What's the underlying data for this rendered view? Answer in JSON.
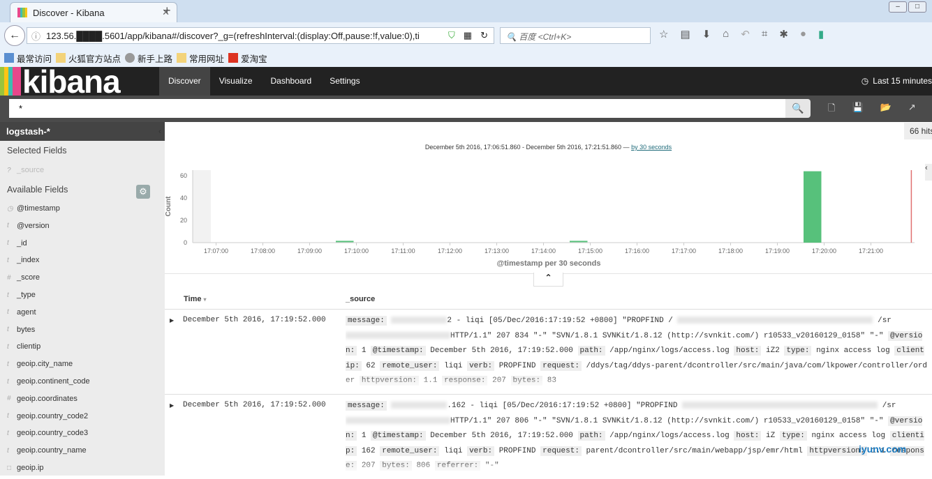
{
  "browser": {
    "tab_title": "Discover - Kibana",
    "url": "123.56.████.5601/app/kibana#/discover?_g=(refreshInterval:(display:Off,pause:!f,value:0),ti",
    "search_placeholder": "百度 <Ctrl+K>",
    "bookmarks": [
      "最常访问",
      "火狐官方站点",
      "新手上路",
      "常用网址",
      "爱淘宝"
    ]
  },
  "kibana": {
    "logo": "kibana",
    "nav": [
      "Discover",
      "Visualize",
      "Dashboard",
      "Settings"
    ],
    "time_picker": "Last 15 minutes",
    "query": "*"
  },
  "colors": {
    "bar": "#57c17b",
    "nav_bg": "#222222",
    "now_line": "#e07070"
  },
  "sidebar": {
    "index_pattern": "logstash-*",
    "selected_title": "Selected Fields",
    "selected": [
      {
        "type": "?",
        "name": "_source"
      }
    ],
    "available_title": "Available Fields",
    "fields": [
      {
        "type": "◷",
        "name": "@timestamp"
      },
      {
        "type": "t",
        "name": "@version"
      },
      {
        "type": "t",
        "name": "_id"
      },
      {
        "type": "t",
        "name": "_index"
      },
      {
        "type": "#",
        "name": "_score"
      },
      {
        "type": "t",
        "name": "_type"
      },
      {
        "type": "t",
        "name": "agent"
      },
      {
        "type": "t",
        "name": "bytes"
      },
      {
        "type": "t",
        "name": "clientip"
      },
      {
        "type": "t",
        "name": "geoip.city_name"
      },
      {
        "type": "t",
        "name": "geoip.continent_code"
      },
      {
        "type": "#",
        "name": "geoip.coordinates"
      },
      {
        "type": "t",
        "name": "geoip.country_code2"
      },
      {
        "type": "t",
        "name": "geoip.country_code3"
      },
      {
        "type": "t",
        "name": "geoip.country_name"
      },
      {
        "type": "□",
        "name": "geoip.ip"
      }
    ]
  },
  "main": {
    "hits": "66 hits",
    "range_text": "December 5th 2016, 17:06:51.860 - December 5th 2016, 17:21:51.860 —",
    "interval_link": "by 30 seconds",
    "columns": [
      "Time",
      "_source"
    ],
    "rows": [
      {
        "time": "December 5th 2016, 17:19:52.000",
        "parts": [
          [
            "message:",
            "2 - liqi [05/Dec/2016:17:19:52 +0800] \"PROPFIND /",
            "/sr"
          ],
          [
            "",
            "HTTP/1.1\" 207 834 \"-\" \"SVN/1.8.1 SVNKit/1.8.12 (http://svnkit.com/) r10533_v20160129_0158\" \"-\""
          ],
          [
            "@version:",
            "1"
          ],
          [
            "@timestamp:",
            "December 5th 2016, 17:19:52.000"
          ],
          [
            "path:",
            "/app/nginx/logs/access.log"
          ],
          [
            "host:",
            "iZ2"
          ],
          [
            "type:",
            "nginx access log"
          ],
          [
            "clientip:",
            "62"
          ],
          [
            "remote_user:",
            "liqi"
          ],
          [
            "verb:",
            "PROPFIND"
          ],
          [
            "request:",
            "/ddys/tag/ddys-parent/dcontroller/src/main/java/com/lkpower/controller/order"
          ],
          [
            "httpversion:",
            "1.1"
          ],
          [
            "response:",
            "207"
          ],
          [
            "bytes:",
            "83"
          ]
        ]
      },
      {
        "time": "December 5th 2016, 17:19:52.000",
        "parts": [
          [
            "message:",
            ".162 - liqi [05/Dec/2016:17:19:52 +0800] \"PROPFIND",
            "/sr"
          ],
          [
            "",
            "HTTP/1.1\" 207 806 \"-\" \"SVN/1.8.1 SVNKit/1.8.12 (http://svnkit.com/) r10533_v20160129_0158\" \"-\""
          ],
          [
            "@version:",
            "1"
          ],
          [
            "@timestamp:",
            "December 5th 2016, 17:19:52.000"
          ],
          [
            "path:",
            "/app/nginx/logs/access.log"
          ],
          [
            "host:",
            "iZ"
          ],
          [
            "type:",
            "nginx access log"
          ],
          [
            "clientip:",
            "162"
          ],
          [
            "remote_user:",
            "liqi"
          ],
          [
            "verb:",
            "PROPFIND"
          ],
          [
            "request:",
            "parent/dcontroller/src/main/webapp/jsp/emr/html"
          ],
          [
            "httpversion:",
            "1.1"
          ],
          [
            "response:",
            "207"
          ],
          [
            "bytes:",
            "806"
          ],
          [
            "referrer:",
            "\"-\""
          ]
        ]
      }
    ]
  },
  "chart_data": {
    "type": "bar",
    "title": "",
    "xlabel": "@timestamp per 30 seconds",
    "ylabel": "Count",
    "x": [
      "17:09:30",
      "17:14:30",
      "17:19:30"
    ],
    "values": [
      1,
      1,
      64
    ],
    "xticks": [
      "17:07:00",
      "17:08:00",
      "17:09:00",
      "17:10:00",
      "17:11:00",
      "17:12:00",
      "17:13:00",
      "17:14:00",
      "17:15:00",
      "17:16:00",
      "17:17:00",
      "17:18:00",
      "17:19:00",
      "17:20:00",
      "17:21:00"
    ],
    "yticks": [
      0,
      20,
      40,
      60
    ],
    "ylim": [
      0,
      65
    ],
    "xlim": [
      "17:06:30",
      "17:22:00"
    ],
    "now": "17:21:51.860"
  },
  "watermark": "iyunv.com"
}
